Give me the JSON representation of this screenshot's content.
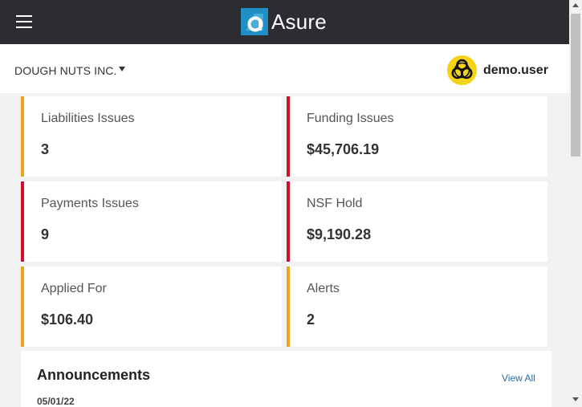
{
  "header": {
    "menu_icon": "hamburger-menu-icon",
    "logo_text": "Asure"
  },
  "subheader": {
    "company_name": "DOUGH NUTS INC.",
    "dropdown_icon": "caret-down-icon",
    "avatar_icon": "biohazard-icon",
    "username": "demo.user"
  },
  "cards": [
    {
      "label": "Liabilities Issues",
      "value": "3",
      "accent": "#f0a41c"
    },
    {
      "label": "Funding Issues",
      "value": "$45,706.19",
      "accent": "#d0102a"
    },
    {
      "label": "Payments Issues",
      "value": "9",
      "accent": "#d0102a"
    },
    {
      "label": "NSF Hold",
      "value": "$9,190.28",
      "accent": "#d0102a"
    },
    {
      "label": "Applied For",
      "value": "$106.40",
      "accent": "#f0a41c"
    },
    {
      "label": "Alerts",
      "value": "2",
      "accent": "#f0a41c"
    }
  ],
  "announcements": {
    "title": "Announcements",
    "view_all": "View All",
    "items": [
      {
        "date": "05/01/22"
      }
    ]
  },
  "colors": {
    "topbar": "#2b2d31",
    "brand_blue": "#1e90c6",
    "accent_orange": "#f0a41c",
    "accent_red": "#d0102a",
    "link": "#2a6aa5"
  }
}
